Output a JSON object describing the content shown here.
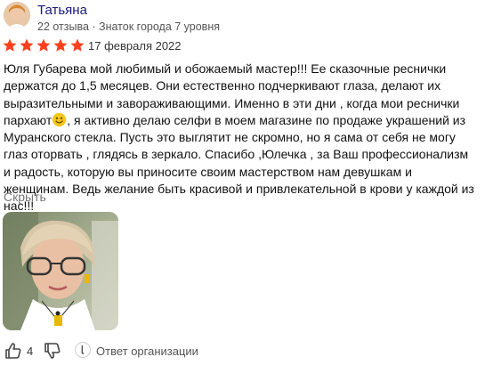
{
  "author": {
    "name": "Татьяна",
    "meta": "22 отзыва · Знаток города 7 уровня"
  },
  "rating": {
    "stars": 5,
    "max_stars": 5,
    "date": "17 февраля 2022",
    "star_color": "#fc3f1d"
  },
  "review": {
    "text_before_emoji": "Юля Губарева мой любимый и обожаемый мастер!!! Ее сказочные реснички держатся до 1,5 месяцев. Они естественно подчеркивают глаза, делают их выразительными и завораживающими. Именно в эти дни , когда мои реснички пархают",
    "emoji_icon": "smiling-face-icon",
    "text_after_emoji": ", я активно делаю селфи в моем магазине по продаже украшений из Муранского стекла. Пусть это выглятит не скромно, но я сама от себя не могу глаз оторвать , глядясь в зеркало. Спасибо ,Юлечка , за Ваш профессионализм и радость, которую вы приносите своим мастерством нам девушкам и женщинам. Ведь желание быть красивой и привлекательной в крови у каждой из нас!!!"
  },
  "hide_label": "Скрыть",
  "footer": {
    "like_icon": "thumbs-up-icon",
    "like_count": "4",
    "dislike_icon": "thumbs-down-icon",
    "org_reply_label": "Ответ организации"
  }
}
